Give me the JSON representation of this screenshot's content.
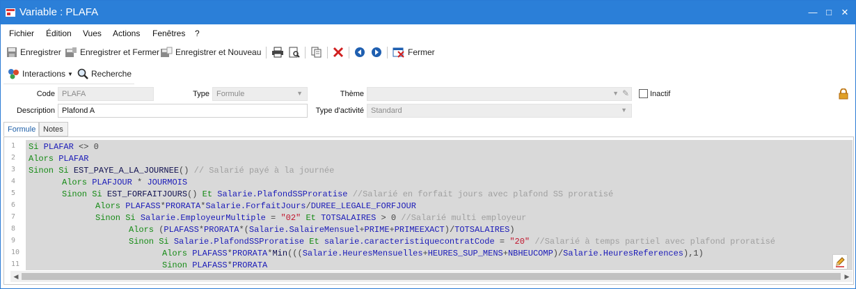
{
  "window": {
    "title": "Variable : PLAFA",
    "controls": {
      "minimize": "—",
      "maximize": "□",
      "close": "✕"
    },
    "accent": "#2b7fd8"
  },
  "menu": [
    "Fichier",
    "Édition",
    "Vues",
    "Actions",
    "Fenêtres",
    "?"
  ],
  "toolbar": {
    "save": "Enregistrer",
    "save_close": "Enregistrer et Fermer",
    "save_new": "Enregistrer et Nouveau",
    "close": "Fermer",
    "icons": [
      "print-icon",
      "print-preview-icon",
      "copy-icon",
      "delete-icon",
      "previous-icon",
      "next-icon",
      "close-form-icon"
    ]
  },
  "subtoolbar": {
    "interactions": "Interactions",
    "search": "Recherche"
  },
  "form": {
    "code_label": "Code",
    "code_value": "PLAFA",
    "type_label": "Type",
    "type_value": "Formule",
    "theme_label": "Thème",
    "theme_value": "",
    "inactive_label": "Inactif",
    "description_label": "Description",
    "description_value": "Plafond A",
    "activity_label": "Type d'activité",
    "activity_value": "Standard"
  },
  "tabs": [
    "Formule",
    "Notes"
  ],
  "editor": {
    "line_numbers": [
      "1",
      "2",
      "3",
      "4",
      "5",
      "6",
      "7",
      "8",
      "9",
      "10",
      "11"
    ]
  }
}
